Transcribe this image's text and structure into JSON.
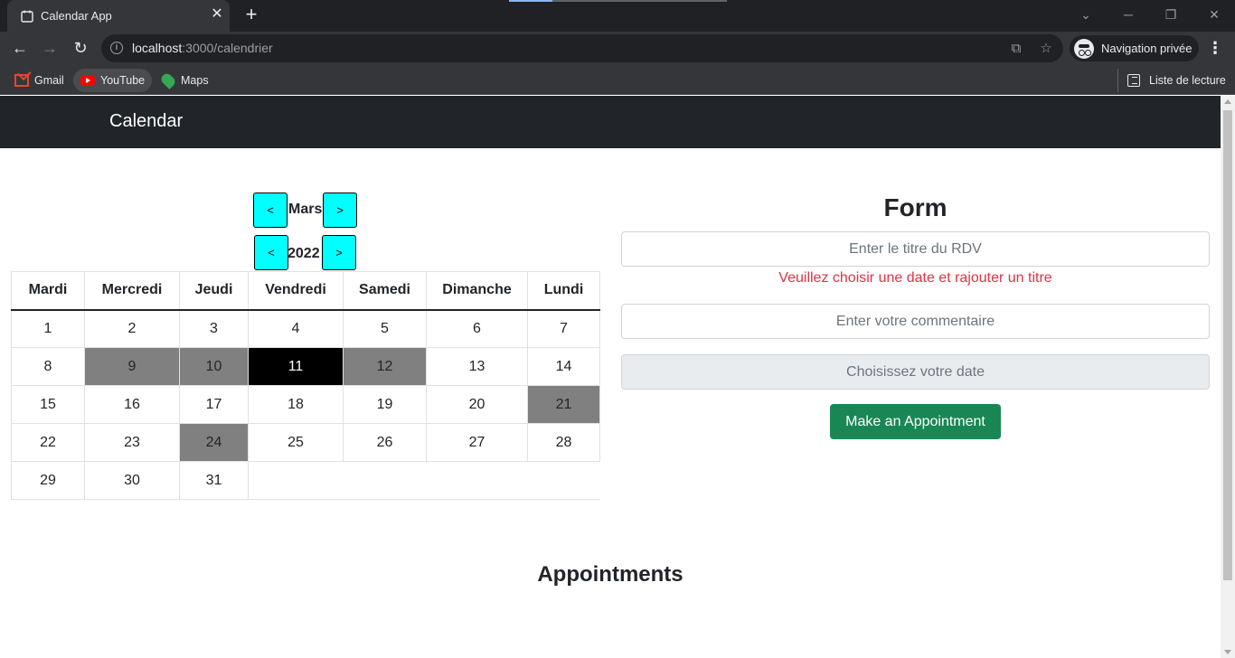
{
  "browser": {
    "tab_title": "Calendar App",
    "tab_close": "✕",
    "new_tab": "+",
    "url_host": "localhost",
    "url_rest": ":3000/calendrier",
    "incognito_label": "Navigation privée",
    "bookmarks": [
      {
        "label": "Gmail"
      },
      {
        "label": "YouTube"
      },
      {
        "label": "Maps"
      }
    ],
    "reading_list": "Liste de lecture"
  },
  "navbar": {
    "brand": "Calendar"
  },
  "calendar": {
    "month": "Mars",
    "year": "2022",
    "prev": "<",
    "next": ">",
    "weekdays": [
      "Mardi",
      "Mercredi",
      "Jeudi",
      "Vendredi",
      "Samedi",
      "Dimanche",
      "Lundi"
    ],
    "weeks": [
      [
        "1",
        "2",
        "3",
        "4",
        "5",
        "6",
        "7"
      ],
      [
        "8",
        "9",
        "10",
        "11",
        "12",
        "13",
        "14"
      ],
      [
        "15",
        "16",
        "17",
        "18",
        "19",
        "20",
        "21"
      ],
      [
        "22",
        "23",
        "24",
        "25",
        "26",
        "27",
        "28"
      ],
      [
        "29",
        "30",
        "31"
      ]
    ],
    "highlighted_days": [
      "9",
      "10",
      "12",
      "21",
      "24"
    ],
    "selected_day": "11",
    "highlight_color": "#808080",
    "selected_color": "#000000",
    "nav_button_color": "#00ffff"
  },
  "form": {
    "title": "Form",
    "title_placeholder": "Enter le titre du RDV",
    "error": "Veuillez choisir une date et rajouter un titre",
    "comment_placeholder": "Enter votre commentaire",
    "date_placeholder": "Choisissez votre date",
    "submit_label": "Make an Appointment",
    "submit_color": "#198754",
    "error_color": "#dc3545"
  },
  "appointments": {
    "title": "Appointments"
  }
}
